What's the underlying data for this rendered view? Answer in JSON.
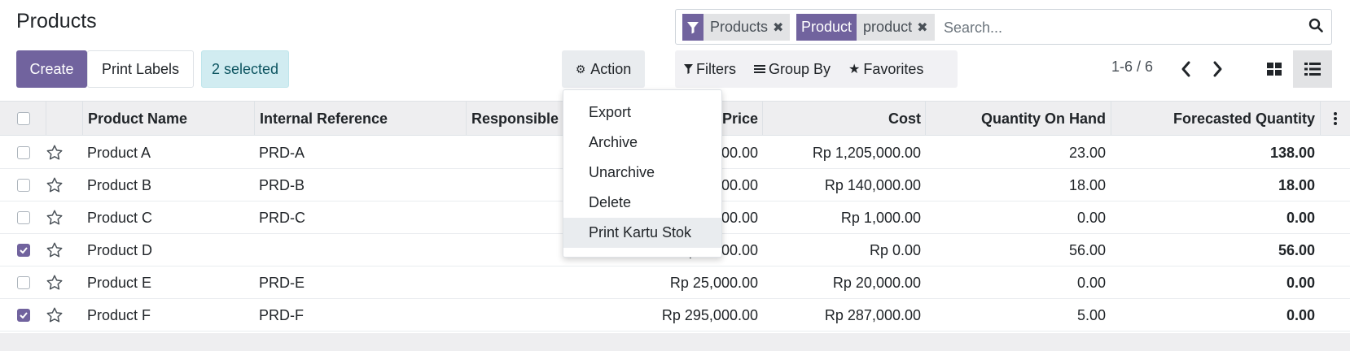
{
  "header": {
    "title": "Products",
    "create_label": "Create",
    "print_labels_label": "Print Labels",
    "selected_label": "2 selected",
    "action_label": "Action"
  },
  "search": {
    "facets": [
      {
        "head_icon": "filter-icon",
        "value": "Products"
      },
      {
        "head": "Product",
        "value": "product"
      }
    ],
    "placeholder": "Search..."
  },
  "filterbar": {
    "filters_label": "Filters",
    "groupby_label": "Group By",
    "favorites_label": "Favorites"
  },
  "pager": {
    "text": "1-6 / 6"
  },
  "table": {
    "columns": [
      "Product Name",
      "Internal Reference",
      "Responsible",
      "Sales Price",
      "Cost",
      "Quantity On Hand",
      "Forecasted Quantity"
    ],
    "rows": [
      {
        "checked": false,
        "name": "Product A",
        "ref": "PRD-A",
        "responsible": "",
        "price": "Rp 1,500,000.00",
        "cost": "Rp 1,205,000.00",
        "qty": "23.00",
        "forecast": "138.00"
      },
      {
        "checked": false,
        "name": "Product B",
        "ref": "PRD-B",
        "responsible": "",
        "price": "Rp 150,000.00",
        "cost": "Rp 140,000.00",
        "qty": "18.00",
        "forecast": "18.00"
      },
      {
        "checked": false,
        "name": "Product C",
        "ref": "PRD-C",
        "responsible": "",
        "price": "Rp 1,000.00",
        "cost": "Rp 1,000.00",
        "qty": "0.00",
        "forecast": "0.00"
      },
      {
        "checked": true,
        "name": "Product D",
        "ref": "",
        "responsible": "",
        "price": "Rp 1,000.00",
        "cost": "Rp 0.00",
        "qty": "56.00",
        "forecast": "56.00"
      },
      {
        "checked": false,
        "name": "Product E",
        "ref": "PRD-E",
        "responsible": "",
        "price": "Rp 25,000.00",
        "cost": "Rp 20,000.00",
        "qty": "0.00",
        "forecast": "0.00"
      },
      {
        "checked": true,
        "name": "Product F",
        "ref": "PRD-F",
        "responsible": "",
        "price": "Rp 295,000.00",
        "cost": "Rp 287,000.00",
        "qty": "5.00",
        "forecast": "0.00"
      }
    ]
  },
  "action_menu": {
    "items": [
      "Export",
      "Archive",
      "Unarchive",
      "Delete",
      "Print Kartu Stok"
    ],
    "active_index": 4
  },
  "colors": {
    "brand": "#71639e",
    "selected_badge_bg": "#d1ecf1",
    "header_bg": "#eeeef0"
  }
}
